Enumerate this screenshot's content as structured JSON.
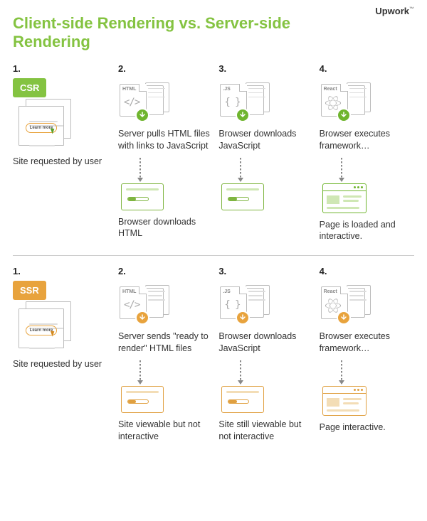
{
  "brand": {
    "name": "Upwork",
    "trademark": "™"
  },
  "title": "Client-side Rendering vs. Server-side Rendering",
  "learn_more": "Learn more",
  "file_labels": {
    "html": "HTML",
    "js": ".JS",
    "react": "React"
  },
  "csr": {
    "badge": "CSR",
    "steps": [
      {
        "num": "1.",
        "caption": "Site requested by user"
      },
      {
        "num": "2.",
        "caption_top": "Server pulls HTML files with links to JavaScript",
        "caption_bottom": "Browser downloads HTML"
      },
      {
        "num": "3.",
        "caption_top": "Browser downloads JavaScript",
        "caption_bottom": ""
      },
      {
        "num": "4.",
        "caption_top": "Browser executes framework…",
        "caption_bottom": "Page is loaded and interactive."
      }
    ]
  },
  "ssr": {
    "badge": "SSR",
    "steps": [
      {
        "num": "1.",
        "caption": "Site requested by user"
      },
      {
        "num": "2.",
        "caption_top": "Server sends \"ready to render\" HTML files",
        "caption_bottom": "Site viewable but not interactive"
      },
      {
        "num": "3.",
        "caption_top": "Browser downloads JavaScript",
        "caption_bottom": "Site still viewable but not interactive"
      },
      {
        "num": "4.",
        "caption_top": "Browser executes framework…",
        "caption_bottom": "Page interactive."
      }
    ]
  },
  "colors": {
    "green": "#84c341",
    "orange": "#e8a33d"
  }
}
